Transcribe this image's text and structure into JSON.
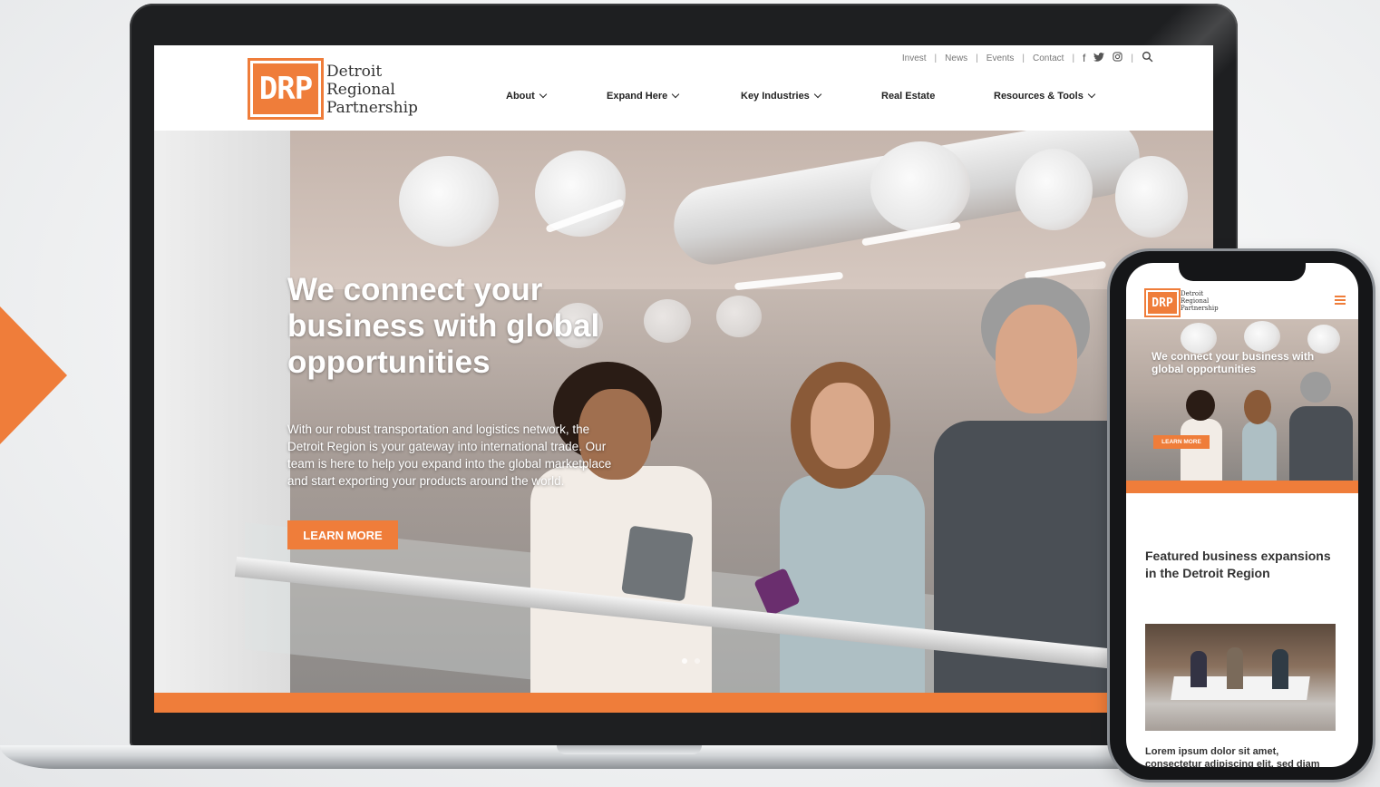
{
  "utility_nav": {
    "items": [
      "Invest",
      "News",
      "Events",
      "Contact"
    ],
    "separator": "|",
    "social": {
      "facebook": "f",
      "twitter": "🐦",
      "instagram": "◎"
    },
    "search_icon": "⌕"
  },
  "logo": {
    "mark": "DRP",
    "line1": "Detroit",
    "line2": "Regional",
    "line3": "Partnership"
  },
  "main_nav": {
    "items": [
      {
        "label": "About",
        "dropdown": true
      },
      {
        "label": "Expand Here",
        "dropdown": true
      },
      {
        "label": "Key Industries",
        "dropdown": true
      },
      {
        "label": "Real Estate",
        "dropdown": false
      },
      {
        "label": "Resources & Tools",
        "dropdown": true
      }
    ]
  },
  "hero": {
    "title": "We connect your business with global opportunities",
    "body": "With our robust transportation and logistics network, the Detroit Region is your gateway into international trade. Our team is here to help you expand into the global marketplace and start exporting your products around the world.",
    "button": "LEARN MORE"
  },
  "mobile": {
    "hero_title": "We connect your business with global opportunities",
    "button": "LEARN MORE",
    "section_title": "Featured business expansions in the Detroit Region",
    "lorem": "Lorem ipsum dolor sit amet, consectetur adipiscing elit, sed diam"
  },
  "colors": {
    "accent": "#ef7d3a",
    "text": "#222222"
  }
}
